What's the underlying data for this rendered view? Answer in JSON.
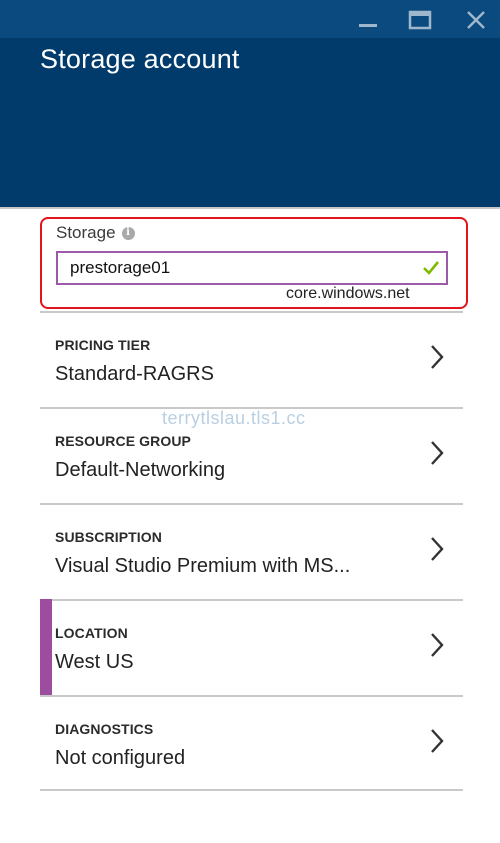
{
  "window": {
    "title": "Storage account",
    "minimize_icon": "minimize-icon",
    "maximize_icon": "maximize-icon",
    "close_icon": "close-icon"
  },
  "storage": {
    "label": "Storage",
    "value": "prestorage01",
    "suffix": "core.windows.net",
    "valid": true
  },
  "settings": [
    {
      "id": "pricing-tier",
      "label": "PRICING TIER",
      "value": "Standard-RAGRS"
    },
    {
      "id": "resource-group",
      "label": "RESOURCE GROUP",
      "value": "Default-Networking"
    },
    {
      "id": "subscription",
      "label": "SUBSCRIPTION",
      "value": "Visual Studio Premium with MS..."
    },
    {
      "id": "location",
      "label": "LOCATION",
      "value": "West US",
      "active": true
    },
    {
      "id": "diagnostics",
      "label": "DIAGNOSTICS",
      "value": "Not configured"
    }
  ],
  "watermark": "terrytlslau.tls1.cc",
  "colors": {
    "header": "#003b6c",
    "accent_purple": "#9c4d9e",
    "input_border": "#9c5aa8",
    "highlight_red": "#e3141c",
    "valid_green": "#7fba00"
  }
}
